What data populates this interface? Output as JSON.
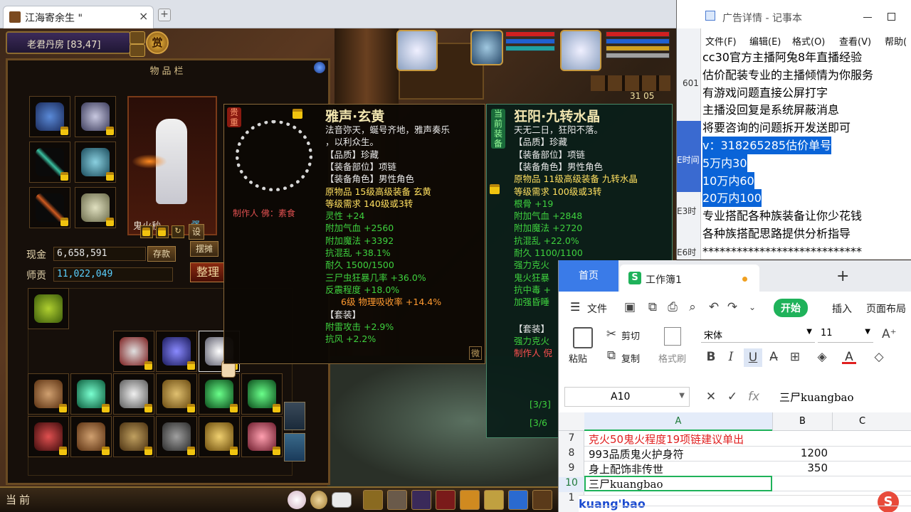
{
  "game": {
    "tab_title": "江海寄余生 \"",
    "tab_close": "×",
    "tab_new": "+",
    "location": "老君丹房 [83,47]",
    "shang_label": "赏",
    "inventory_title": "物品栏",
    "character_name": "鬼火秒",
    "char_badge": "强",
    "settings_label": "设",
    "money_label": "现金",
    "money_value": "6,658,591",
    "deposit_button": "存款",
    "stall_button": "摆摊",
    "teacher_label": "师贡",
    "teacher_value": "11,022,049",
    "sort_button": "整理",
    "bag_page": "2",
    "now_label": "当前",
    "hud_numbers": "31 05",
    "colors": {
      "gold": "#f1c40f",
      "green": "#3ed13e",
      "cyan": "#b4b4ff",
      "red": "#ff5050",
      "orange": "#ff9a30"
    }
  },
  "tooltip1": {
    "tag": "贵\n重",
    "name": "雅声·玄黄",
    "maker": "制作人 佛：素食",
    "lines": [
      {
        "t": "法音弥天，蜒号齐地，雅声奏乐",
        "c": "w"
      },
      {
        "t": "，以利众生。",
        "c": "w"
      },
      {
        "t": "【品质】珍藏",
        "c": "w"
      },
      {
        "t": "【装备部位】项链",
        "c": "w"
      },
      {
        "t": "【装备角色】男性角色",
        "c": "w"
      },
      {
        "t": "原物品  15级高级装备  玄黄",
        "c": "y"
      },
      {
        "t": "等级需求  140级或3转",
        "c": "y"
      },
      {
        "t": "灵性  +24",
        "c": "g"
      },
      {
        "t": "附加气血  +2560",
        "c": "g"
      },
      {
        "t": "附加魔法  +3392",
        "c": "g"
      },
      {
        "t": "抗混乱  +38.1%",
        "c": "g"
      },
      {
        "t": "耐久  1500/1500",
        "c": "g"
      },
      {
        "t": "三尸虫狂暴几率  +36.0%",
        "c": "g"
      },
      {
        "t": "反震程度  +18.0%",
        "c": "g"
      },
      {
        "t": "6级  物理吸收率  +14.4%",
        "c": "o"
      },
      {
        "t": "【套装】",
        "c": "w"
      },
      {
        "t": "附雷攻击  +2.9%",
        "c": "g"
      },
      {
        "t": "抗风  +2.2%",
        "c": "g"
      }
    ],
    "corner": "微"
  },
  "tooltip2": {
    "tag": "当\n前\n装\n备",
    "name": "狂阳·九转水晶",
    "lines": [
      {
        "t": "天无二日，狂阳不落。",
        "c": "w"
      },
      {
        "t": "【品质】珍藏",
        "c": "w"
      },
      {
        "t": "【装备部位】项链",
        "c": "w"
      },
      {
        "t": "【装备角色】男性角色",
        "c": "w"
      },
      {
        "t": "原物品  11级高级装备  九转水晶",
        "c": "y"
      },
      {
        "t": "等级需求  100级或3转",
        "c": "y"
      },
      {
        "t": "根骨  +19",
        "c": "g"
      },
      {
        "t": "附加气血  +2848",
        "c": "g"
      },
      {
        "t": "附加魔法  +2720",
        "c": "g"
      },
      {
        "t": "抗混乱  +22.0%",
        "c": "g"
      },
      {
        "t": "耐久  1100/1100",
        "c": "g"
      },
      {
        "t": "强力克火",
        "c": "g"
      },
      {
        "t": "鬼火狂暴",
        "c": "g"
      },
      {
        "t": "抗中毒  +",
        "c": "g"
      },
      {
        "t": "加强昏睡",
        "c": "g"
      }
    ],
    "set_label": "【套装】",
    "set_line": "强力克火",
    "maker": "制作人  倪",
    "set_count_1": "[3/3]",
    "set_count_2": "[3/6"
  },
  "notepad": {
    "title": "广告详情 - 记事本",
    "menu": [
      "文件(F)",
      "编辑(E)",
      "格式(O)",
      "查看(V)",
      "帮助("
    ],
    "lines": [
      {
        "t": "cc30官方主播阿兔8年直播经验",
        "sel": false
      },
      {
        "t": "估价配装专业的主播倾情为你服务",
        "sel": false
      },
      {
        "t": "有游戏问题直接公屏打字",
        "sel": false
      },
      {
        "t": "主播没回复是系统屏蔽消息",
        "sel": false
      },
      {
        "t": "将要咨询的问题拆开发送即可",
        "sel": false
      },
      {
        "t": "v：318265285估价单号",
        "sel": true
      },
      {
        "t": "5万内30",
        "sel": true
      },
      {
        "t": "10万内60",
        "sel": true
      },
      {
        "t": "20万内100",
        "sel": true
      },
      {
        "t": "专业搭配各种族装备让你少花钱",
        "sel": false
      },
      {
        "t": "各种族搭配思路提供分析指导",
        "sel": false
      },
      {
        "t": "****************************",
        "sel": false
      }
    ],
    "side_labels": [
      "601",
      "E时间",
      "E3时",
      "E6时"
    ]
  },
  "wps": {
    "home_tab": "首页",
    "sheet_tab": "工作簿1",
    "file_menu": "文件",
    "start_tab": "开始",
    "insert_tab": "插入",
    "layout_tab": "页面布局",
    "cut": "剪切",
    "copy": "复制",
    "paste": "粘贴",
    "format_brush": "格式刷",
    "font_name": "宋体",
    "font_size": "11",
    "cell_ref": "A10",
    "formula_value": "三尸kuangbao",
    "fx": "fx",
    "columns": [
      "A",
      "B",
      "C"
    ],
    "rows": [
      {
        "num": "7",
        "a": "克火50鬼火程度19项链建议单出",
        "b": "",
        "red": true
      },
      {
        "num": "8",
        "a": "993品质鬼火护身符",
        "b": "1200",
        "red": false
      },
      {
        "num": "9",
        "a": "身上配饰非传世",
        "b": "350",
        "red": false
      },
      {
        "num": "10",
        "a": "三尸kuangbao",
        "b": "",
        "red": false
      },
      {
        "num": "1",
        "a": "",
        "b": "",
        "red": false
      }
    ],
    "ime_text": "kuang'bao",
    "colors": {
      "accent": "#3a7be8",
      "green": "#1fb25a",
      "red": "#e02020"
    }
  }
}
